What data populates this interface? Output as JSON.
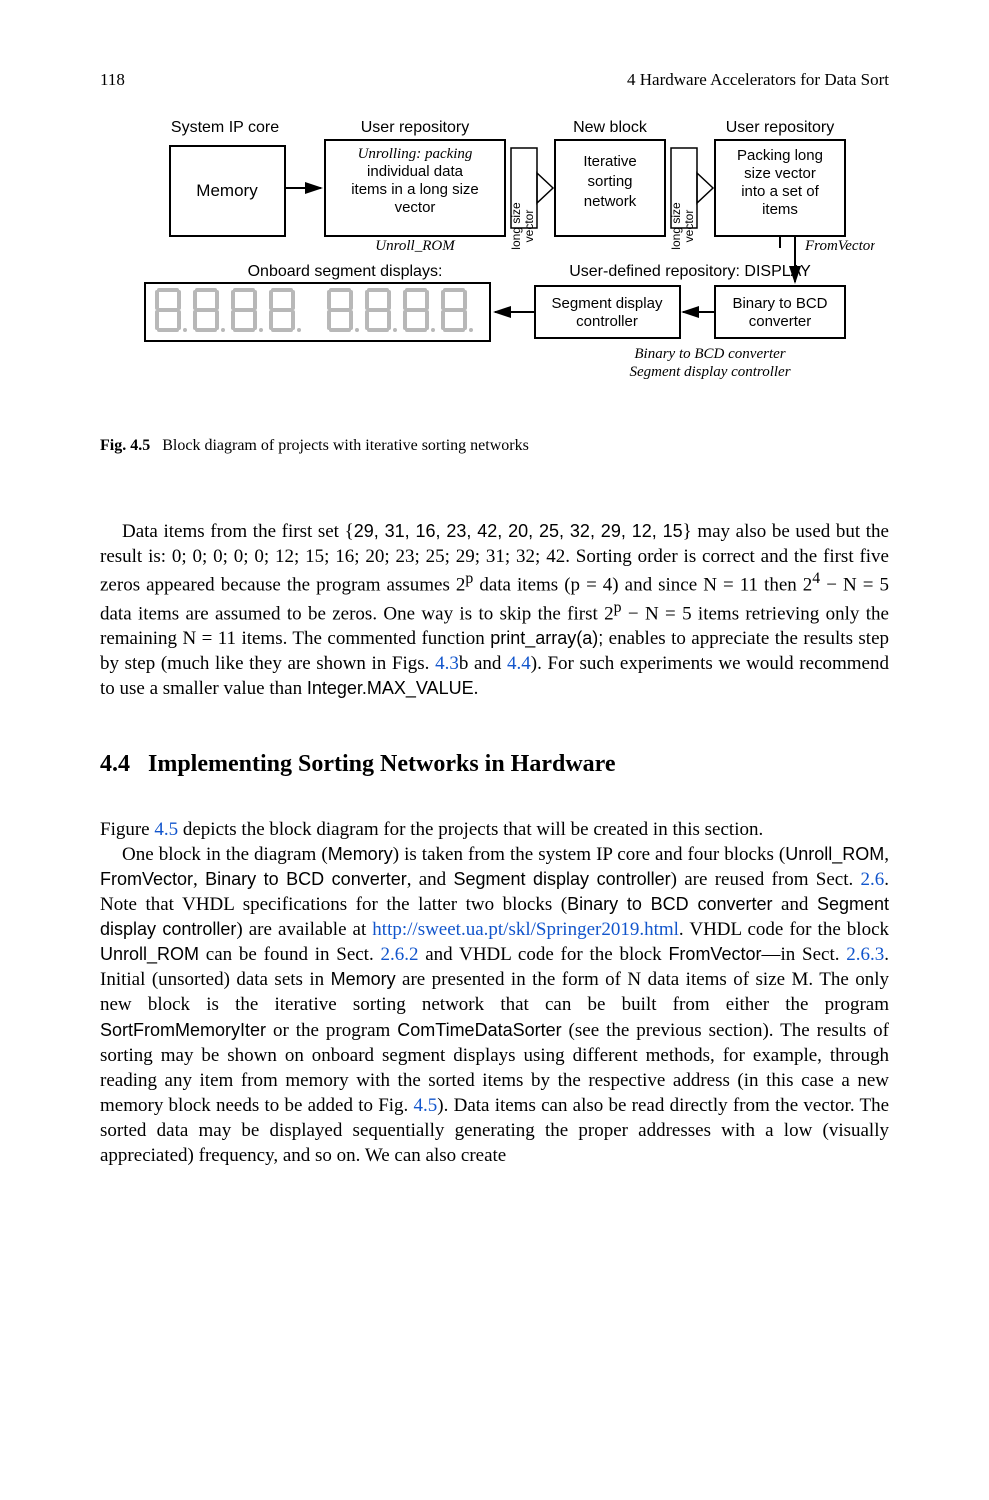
{
  "header": {
    "page_num": "118",
    "chapter": "4   Hardware Accelerators for Data Sort"
  },
  "diagram": {
    "top_labels": {
      "system_ip": "System IP core",
      "user_repo_1": "User repository",
      "new_block": "New block",
      "user_repo_2": "User repository"
    },
    "boxes": {
      "memory": "Memory",
      "unrolling_l1": "Unrolling: packing",
      "unrolling_l2": "individual data",
      "unrolling_l3": "items in a long size",
      "unrolling_l4": "vector",
      "iterative_l1": "Iterative",
      "iterative_l2": "sorting",
      "iterative_l3": "network",
      "packing_l1": "Packing long",
      "packing_l2": "size vector",
      "packing_l3": "into a set of",
      "packing_l4": "items",
      "seg_disp_l1": "Segment display",
      "seg_disp_l2": "controller",
      "b2bcd_l1": "Binary to BCD",
      "b2bcd_l2": "converter"
    },
    "side_labels": {
      "long_size_l1": "long size",
      "long_size_l2": "vector"
    },
    "under_labels": {
      "unroll_rom": "Unroll_ROM",
      "from_vector": "FromVector",
      "onboard_seg": "Onboard segment displays:",
      "user_def_repo": "User-defined repository: DISPLAY",
      "under_b2bcd_l1": "Binary to BCD converter",
      "under_b2bcd_l2": "Segment display controller"
    }
  },
  "caption": {
    "label": "Fig. 4.5",
    "text": "Block diagram of projects with iterative sorting networks"
  },
  "para1": {
    "pre": "Data items from the first set {",
    "set": "29, 31, 16, 23, 42, 20, 25, 32, 29, 12, 15",
    "post1": "} may also be used but the result is: 0; 0; 0; 0; 0; 12; 15; 16; 20; 23; 25; 29; 31; 32; 42. Sorting order is correct and the first five zeros appeared because the program assumes 2",
    "sup_p": "p",
    "post2": " data items (p = 4) and since N = 11 then 2",
    "sup_4": "4",
    "post3": " − N = 5 data items are assumed to be zeros. One way is to skip the first 2",
    "sup_p2": "p",
    "post4": " − N = 5 items retrieving only the remaining N = 11 items. The commented function ",
    "code1": "print_array(a);",
    "post5": " enables to appreciate the results step by step (much like they are shown in Figs. ",
    "ref1": "4.3",
    "post6": "b and ",
    "ref2": "4.4",
    "post7": "). For such experiments we would recommend to use a smaller value than ",
    "code2": "Integer.MAX_VALUE",
    "post8": "."
  },
  "section": {
    "num": "4.4",
    "title": "Implementing Sorting Networks in Hardware"
  },
  "para2": {
    "t1": "Figure ",
    "ref1": "4.5",
    "t2": " depicts the block diagram for the projects that will be created in this section."
  },
  "para3": {
    "t1": "One block in the diagram (",
    "c1": "Memory",
    "t2": ") is taken from the system IP core and four blocks (",
    "c2": "Unroll_ROM",
    "t3": ", ",
    "c3": "FromVector",
    "t4": ", ",
    "c4": "Binary to BCD converter",
    "t5": ", and ",
    "c5": "Segment display controller",
    "t6": ") are reused from Sect. ",
    "ref1": "2.6",
    "t7": ". Note that VHDL specifications for the latter two blocks (",
    "c6": "Binary to BCD converter",
    "t8": " and ",
    "c7": "Segment display controller",
    "t9": ") are available at ",
    "url": "http://sweet.ua.pt/skl/Springer2019.html",
    "t10": ". VHDL code for the block ",
    "c8": "Unroll_ROM",
    "t11": " can be found in Sect. ",
    "ref2": "2.6.2",
    "t12": " and VHDL code for the block ",
    "c9": "FromVector",
    "t13": "—in Sect. ",
    "ref3": "2.6.3",
    "t14": ". Initial (unsorted) data sets in ",
    "c10": "Memory",
    "t15": " are presented in the form of N data items of size M. The only new block is the iterative sorting network that can be built from either the program ",
    "c11": "SortFromMemoryIter",
    "t16": " or the program ",
    "c12": "ComTimeDataSorter",
    "t17": " (see the previous section). The results of sorting may be shown on onboard segment displays using different methods, for example, through reading any item from memory with the sorted items by the respective address (in this case a new memory block needs to be added to Fig. ",
    "ref4": "4.5",
    "t18": "). Data items can also be read directly from the vector. The sorted data may be displayed sequentially generating the proper addresses with a low (visually appreciated) frequency, and so on. We can also create"
  }
}
